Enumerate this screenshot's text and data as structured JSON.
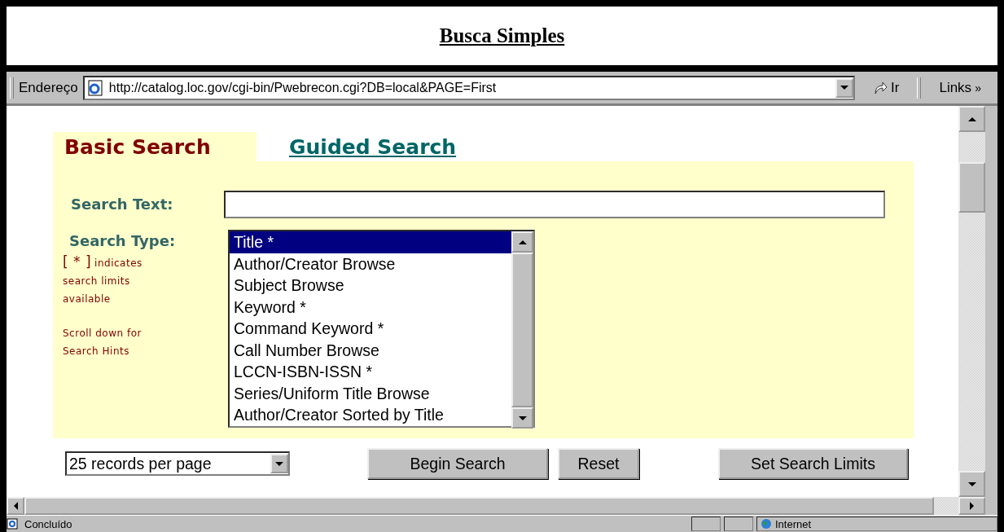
{
  "title": "Busca Simples",
  "address_bar": {
    "label": "Endereço",
    "url": "http://catalog.loc.gov/cgi-bin/Pwebrecon.cgi?DB=local&PAGE=First",
    "go_button": "Ir",
    "links_button": "Links",
    "links_chevron": "»"
  },
  "tabs": [
    {
      "label": "Basic Search",
      "selected": true
    },
    {
      "label": "Guided Search",
      "selected": false
    }
  ],
  "search_text": {
    "label": "Search Text:"
  },
  "search_type": {
    "label": "Search Type:",
    "note_mark": "[ * ]",
    "note": "indicates search limits available",
    "hint": "Scroll down for Search Hints",
    "options": [
      {
        "label": "Title *",
        "selected": true
      },
      {
        "label": "Author/Creator Browse",
        "selected": false
      },
      {
        "label": "Subject Browse",
        "selected": false
      },
      {
        "label": "Keyword *",
        "selected": false
      },
      {
        "label": "Command Keyword *",
        "selected": false
      },
      {
        "label": "Call Number Browse",
        "selected": false
      },
      {
        "label": "LCCN-ISBN-ISSN *",
        "selected": false
      },
      {
        "label": "Series/Uniform Title Browse",
        "selected": false
      },
      {
        "label": "Author/Creator Sorted by Title",
        "selected": false
      }
    ]
  },
  "records_select": "25 records per page",
  "buttons": [
    "Begin Search",
    "Reset",
    "Set Search Limits"
  ],
  "status_bar": {
    "message": "Concluído",
    "zone": "Internet"
  }
}
